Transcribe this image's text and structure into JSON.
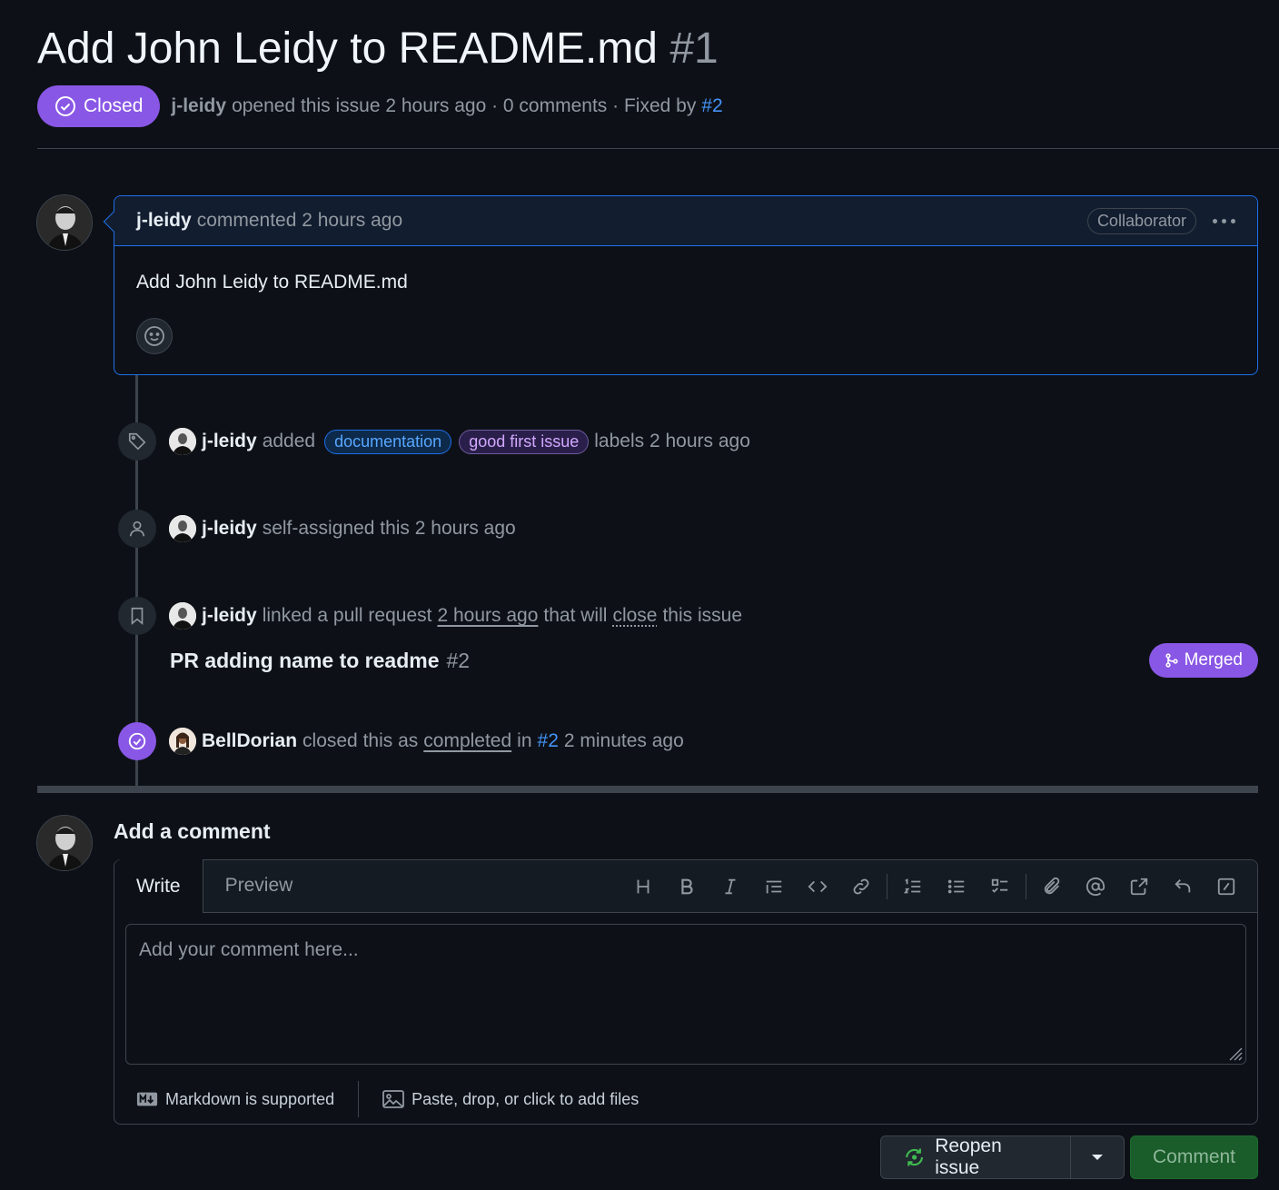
{
  "issue": {
    "title": "Add John Leidy to README.md",
    "number": "#1",
    "state": "Closed",
    "author": "j-leidy",
    "opened_text": "opened this issue 2 hours ago · 0 comments · Fixed by",
    "fixed_by": "#2"
  },
  "comment": {
    "author": "j-leidy",
    "time_text": "commented 2 hours ago",
    "role": "Collaborator",
    "body": "Add John Leidy to README.md"
  },
  "timeline": {
    "labels_event": {
      "actor": "j-leidy",
      "verb": "added",
      "labels": [
        "documentation",
        "good first issue"
      ],
      "suffix": "labels 2 hours ago"
    },
    "assign_event": {
      "actor": "j-leidy",
      "text": "self-assigned this 2 hours ago"
    },
    "link_event": {
      "actor": "j-leidy",
      "text1": "linked a pull request",
      "time": "2 hours ago",
      "text2": "that will",
      "close_word": "close",
      "text3": "this issue"
    },
    "pull_request": {
      "title": "PR adding name to readme",
      "number": "#2",
      "status": "Merged"
    },
    "close_event": {
      "actor": "BellDorian",
      "text1": "closed this as",
      "reason": "completed",
      "text2": "in",
      "ref": "#2",
      "time": "2 minutes ago"
    }
  },
  "composer": {
    "heading": "Add a comment",
    "tabs": [
      "Write",
      "Preview"
    ],
    "placeholder": "Add your comment here...",
    "markdown_note": "Markdown is supported",
    "files_note": "Paste, drop, or click to add files",
    "reopen_label": "Reopen issue",
    "comment_label": "Comment"
  },
  "colors": {
    "closed_purple": "#8957e5",
    "link_blue": "#4493f8",
    "background": "#0d1117"
  }
}
